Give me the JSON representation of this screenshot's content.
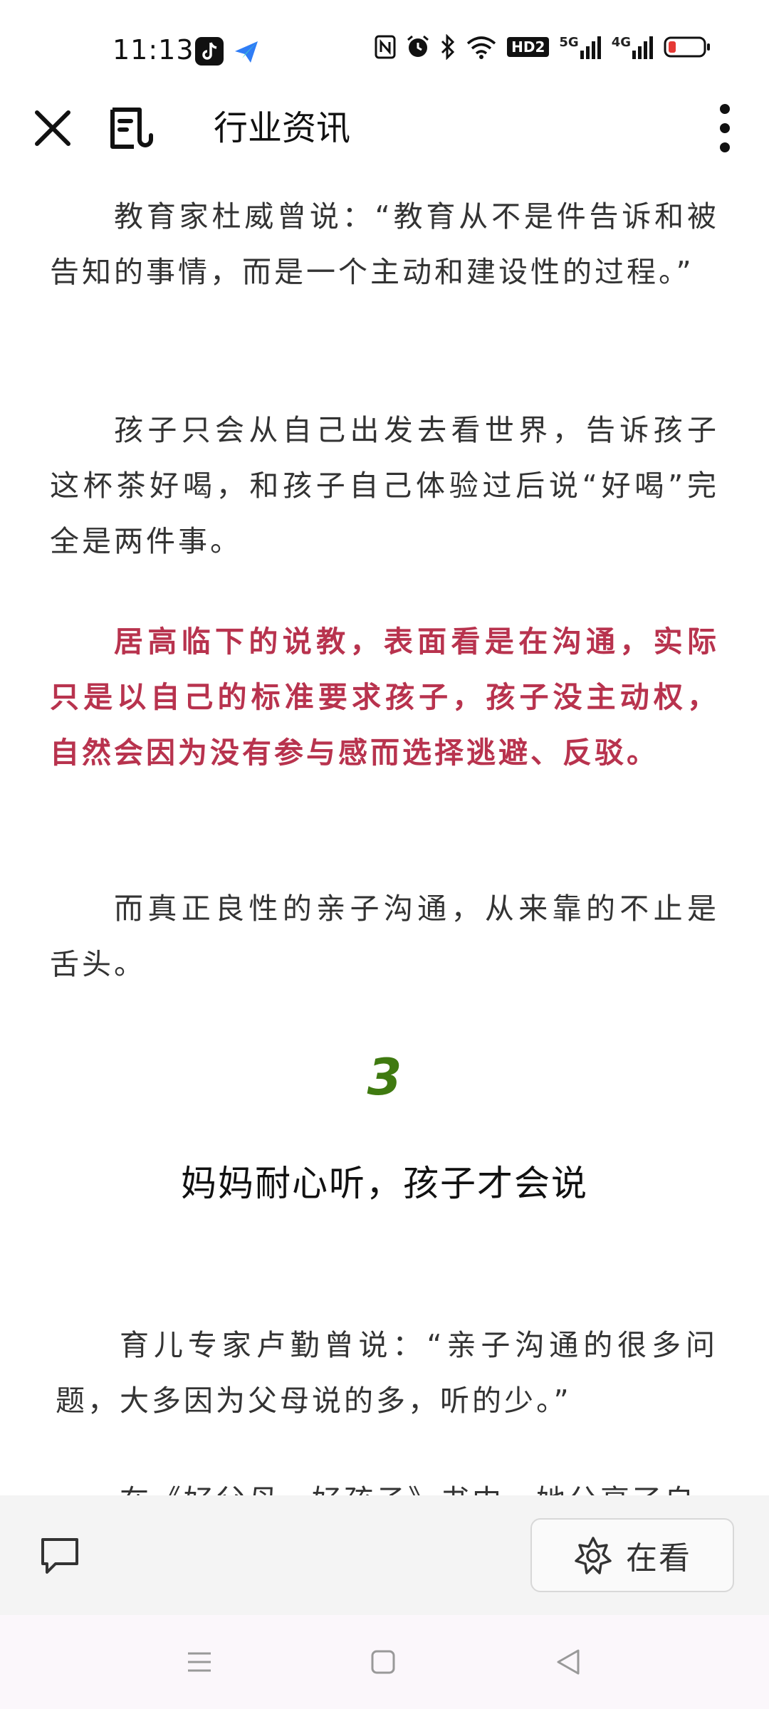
{
  "status_bar": {
    "time": "11:13",
    "icons": [
      "tiktok-icon",
      "feishu-icon",
      "nfc-icon",
      "alarm-icon",
      "bluetooth-icon",
      "wifi-icon",
      "hd2-icon",
      "signal-5g-icon",
      "signal-4g-icon",
      "battery-low-icon"
    ],
    "hd_label": "HD2",
    "net1": "5G",
    "net2": "4G"
  },
  "app_bar": {
    "title": "行业资讯"
  },
  "article": {
    "paragraphs": [
      "教育家杜威曾说：“教育从不是件告诉和被告知的事情，而是一个主动和建设性的过程。”",
      "孩子只会从自己出发去看世界，告诉孩子这杯茶好喝，和孩子自己体验过后说“好喝”完全是两件事。",
      "居高临下的说教，表面看是在沟通，实际只是以自己的标准要求孩子，孩子没主动权，自然会因为没有参与感而选择逃避、反驳。",
      "而真正良性的亲子沟通，从来靠的不止是舌头。"
    ],
    "section_number": "3",
    "section_title": "妈妈耐心听，孩子才会说",
    "paragraphs2": [
      "育儿专家卢勤曾说：“亲子沟通的很多问题，大多因为父母说的多，听的少。”",
      "在《好父母，好孩子》书中，她分享了自"
    ]
  },
  "bottom_bar": {
    "zaikan_label": "在看"
  },
  "colors": {
    "highlight_red": "#b8334e",
    "section_green": "#3f7a10"
  }
}
